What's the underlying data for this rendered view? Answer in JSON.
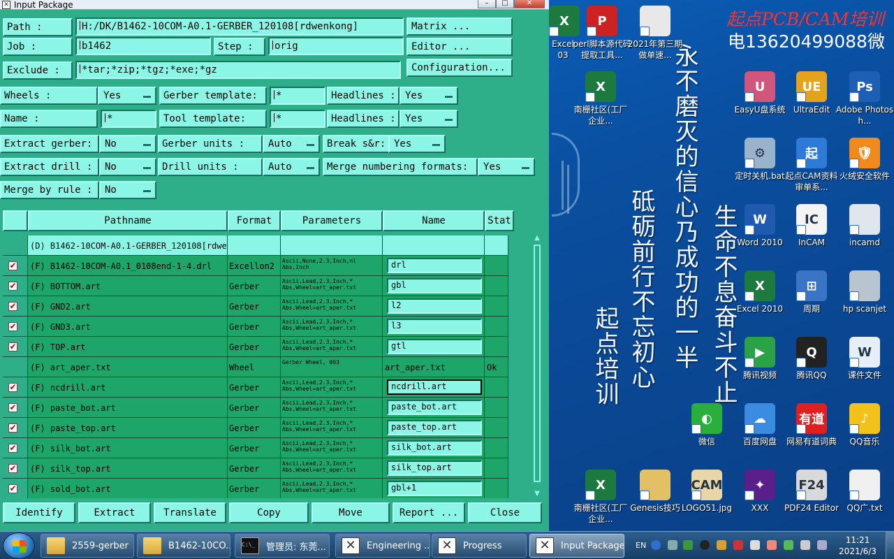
{
  "window": {
    "title": "Input Package",
    "controls": [
      "–",
      "□",
      "✕"
    ]
  },
  "form": {
    "path_label": "Path      :",
    "path_value": "H:/DK/B1462-10COM-A0.1-GERBER_120108[rdwenkong]",
    "job_label": "Job      :",
    "job_value": "b1462",
    "step_label": "Step :",
    "step_value": "orig",
    "exclude_label": "Exclude  :",
    "exclude_value": "*tar;*zip;*tgz;*exe;*gz",
    "matrix_btn": "Matrix ...",
    "editor_btn": "Editor ...",
    "config_btn": "Configuration...",
    "wheels_label": "Wheels        :",
    "wheels_value": "Yes",
    "gerber_template_label": "Gerber template:",
    "gerber_template_value": "*",
    "headlines1_label": "Headlines  :",
    "headlines1_value": "Yes",
    "name_label": "Name          :",
    "name_value": "*",
    "tool_template_label": "Tool   template:",
    "tool_template_value": "*",
    "headlines2_label": "Headlines  :",
    "headlines2_value": "Yes",
    "extract_gerber_label": "Extract gerber:",
    "extract_gerber_value": "No",
    "gerber_units_label": "Gerber units     :",
    "gerber_units_value": "Auto",
    "break_sr_label": "Break s&r:",
    "break_sr_value": "Yes",
    "extract_drill_label": "Extract drill :",
    "extract_drill_value": "No",
    "drill_units_label": "Drill  units     :",
    "drill_units_value": "Auto",
    "merge_numbering_label": "Merge numbering formats:",
    "merge_numbering_value": "Yes",
    "merge_rule_label": "Merge by rule :",
    "merge_rule_value": "No"
  },
  "table": {
    "headers": [
      "Pathname",
      "Format",
      "Parameters",
      "Name",
      "Stat"
    ],
    "rows": [
      {
        "checked": false,
        "path": "(D) B1462-10COM-A0.1-GERBER_120108[rdwen",
        "format": "",
        "params": "",
        "name": "",
        "stat": "",
        "editable": false
      },
      {
        "checked": true,
        "path": "(F) B1462-10COM-A0.1_0108end-1-4.drl",
        "format": "Excellon2",
        "params": "Ascii,None,2.3,Inch,nl Abs,Inch",
        "name": "drl",
        "stat": "",
        "editable": true
      },
      {
        "checked": true,
        "path": "(F) BOTTOM.art",
        "format": "Gerber",
        "params": "Ascii,Lead,2.3,Inch,* Abs,Wheel=art_aper.txt",
        "name": "gbl",
        "stat": "",
        "editable": true
      },
      {
        "checked": true,
        "path": "(F) GND2.art",
        "format": "Gerber",
        "params": "Ascii,Lead,2.3,Inch,* Abs,Wheel=art_aper.txt",
        "name": "l2",
        "stat": "",
        "editable": true
      },
      {
        "checked": true,
        "path": "(F) GND3.art",
        "format": "Gerber",
        "params": "Ascii,Lead,2.3,Inch,* Abs,Wheel=art_aper.txt",
        "name": "l3",
        "stat": "",
        "editable": true
      },
      {
        "checked": true,
        "path": "(F) TOP.art",
        "format": "Gerber",
        "params": "Ascii,Lead,2.3,Inch,* Abs,Wheel=art_aper.txt",
        "name": "gtl",
        "stat": "",
        "editable": true
      },
      {
        "checked": false,
        "path": "(F) art_aper.txt",
        "format": "Wheel",
        "params": "Gerber Wheel, 003",
        "name": "art_aper.txt",
        "stat": "Ok",
        "editable": false
      },
      {
        "checked": true,
        "path": "(F) ncdrill.art",
        "format": "Gerber",
        "params": "Ascii,Lead,2.3,Inch,* Abs,Wheel=art_aper.txt",
        "name": "ncdrill.art",
        "stat": "",
        "editable": true,
        "selected": true
      },
      {
        "checked": true,
        "path": "(F) paste_bot.art",
        "format": "Gerber",
        "params": "Ascii,Lead,2.3,Inch,* Abs,Wheel=art_aper.txt",
        "name": "paste_bot.art",
        "stat": "",
        "editable": true
      },
      {
        "checked": true,
        "path": "(F) paste_top.art",
        "format": "Gerber",
        "params": "Ascii,Lead,2.3,Inch,* Abs,Wheel=art_aper.txt",
        "name": "paste_top.art",
        "stat": "",
        "editable": true
      },
      {
        "checked": true,
        "path": "(F) silk_bot.art",
        "format": "Gerber",
        "params": "Ascii,Lead,2.3,Inch,* Abs,Wheel=art_aper.txt",
        "name": "silk_bot.art",
        "stat": "",
        "editable": true
      },
      {
        "checked": true,
        "path": "(F) silk_top.art",
        "format": "Gerber",
        "params": "Ascii,Lead,2.3,Inch,* Abs,Wheel=art_aper.txt",
        "name": "silk_top.art",
        "stat": "",
        "editable": true
      },
      {
        "checked": true,
        "path": "(F) sold_bot.art",
        "format": "Gerber",
        "params": "Ascii,Lead,2.3,Inch,* Abs,Wheel=art_aper.txt",
        "name": "gbl+1",
        "stat": "",
        "editable": true
      }
    ]
  },
  "bottom_buttons": [
    "Identify",
    "Extract",
    "Translate",
    "Copy",
    "Move",
    "Report ...",
    "Close"
  ],
  "desktop": {
    "brand_line1": "起点PCB/CAM培训",
    "brand_line2": "电13620499088微",
    "slogans": [
      "永不磨灭的信心乃成功的一半",
      "砥砺前行不忘初心",
      "生命不息奋斗不止",
      "起点培训"
    ],
    "icons": [
      {
        "label": "Excel\n03",
        "icon": "excel-icon",
        "color": "#1d7a3e",
        "glyph": "X"
      },
      {
        "label": "perl脚本源代码提取工具...",
        "icon": "perl-icon",
        "color": "#c22",
        "glyph": "P"
      },
      {
        "label": "2021年第三期做单速...",
        "icon": "document-icon",
        "color": "#e8e8e8",
        "glyph": ""
      },
      {
        "label": "南栅社区(工厂企业...",
        "icon": "excel-icon",
        "color": "#1d7a3e",
        "glyph": "X"
      },
      {
        "label": "EasyU盘系统",
        "icon": "easyu-icon",
        "color": "#d0577b",
        "glyph": "U"
      },
      {
        "label": "UltraEdit",
        "icon": "ultraedit-icon",
        "color": "#e3a31c",
        "glyph": "UE"
      },
      {
        "label": "Adobe Photosh...",
        "icon": "photoshop-icon",
        "color": "#1c5fb5",
        "glyph": "Ps"
      },
      {
        "label": "定时关机.bat",
        "icon": "gear-icon",
        "color": "#9ab3cc",
        "glyph": "⚙"
      },
      {
        "label": "起点CAM资料审单系...",
        "icon": "cam-icon",
        "color": "#2e7ad6",
        "glyph": "起"
      },
      {
        "label": "火绒安全软件",
        "icon": "shield-icon",
        "color": "#f08a1c",
        "glyph": "🛡"
      },
      {
        "label": "Word 2010",
        "icon": "word-icon",
        "color": "#1f5ab0",
        "glyph": "W"
      },
      {
        "label": "InCAM",
        "icon": "incam-icon",
        "color": "#f4f4f4",
        "glyph": "IC"
      },
      {
        "label": "incamd",
        "icon": "incamd-icon",
        "color": "#dfe6ee",
        "glyph": ""
      },
      {
        "label": "Excel 2010",
        "icon": "excel-icon",
        "color": "#1d7a3e",
        "glyph": "X"
      },
      {
        "label": "周期",
        "icon": "windows-icon",
        "color": "#3a74c4",
        "glyph": "⊞"
      },
      {
        "label": "hp scanjet",
        "icon": "scanner-icon",
        "color": "#b8c4d0",
        "glyph": ""
      },
      {
        "label": "腾讯视频",
        "icon": "video-icon",
        "color": "#2ba245",
        "glyph": "▶"
      },
      {
        "label": "腾讯QQ",
        "icon": "qq-icon",
        "color": "#222",
        "glyph": "Q"
      },
      {
        "label": "课件文件",
        "icon": "word-icon",
        "color": "#e6eef8",
        "glyph": "W"
      },
      {
        "label": "微信",
        "icon": "wechat-icon",
        "color": "#2aae3c",
        "glyph": "◐"
      },
      {
        "label": "百度网盘",
        "icon": "cloud-icon",
        "color": "#3b8be0",
        "glyph": "☁"
      },
      {
        "label": "网易有道词典",
        "icon": "youdao-icon",
        "color": "#e02020",
        "glyph": "有道"
      },
      {
        "label": "QQ音乐",
        "icon": "music-icon",
        "color": "#f2c21a",
        "glyph": "♪"
      },
      {
        "label": "南栅社区(工厂企业...",
        "icon": "excel-icon",
        "color": "#1d7a3e",
        "glyph": "X"
      },
      {
        "label": "Genesis技巧",
        "icon": "folder-icon",
        "color": "#e2c063",
        "glyph": ""
      },
      {
        "label": "LOGO51.jpg",
        "icon": "image-icon",
        "color": "#e9d6a8",
        "glyph": "CAM"
      },
      {
        "label": "XXX",
        "icon": "xxx-icon",
        "color": "#5a1f8a",
        "glyph": "✦"
      },
      {
        "label": "PDF24 Editor",
        "icon": "pdf-icon",
        "color": "#d9d9d9",
        "glyph": "F24"
      },
      {
        "label": "QQ广.txt",
        "icon": "text-file-icon",
        "color": "#f0f0f0",
        "glyph": ""
      }
    ]
  },
  "taskbar": {
    "tasks": [
      {
        "label": "2559-gerber",
        "icon": "folder"
      },
      {
        "label": "B1462-10CO...",
        "icon": "folder"
      },
      {
        "label": "管理员: 东莞...",
        "icon": "cmd"
      },
      {
        "label": "Engineering ...",
        "icon": "x"
      },
      {
        "label": "Progress",
        "icon": "x"
      },
      {
        "label": "Input Package",
        "icon": "x",
        "active": true
      }
    ],
    "tray_lang": "EN",
    "time": "11:21",
    "date": "2021/6/3"
  }
}
